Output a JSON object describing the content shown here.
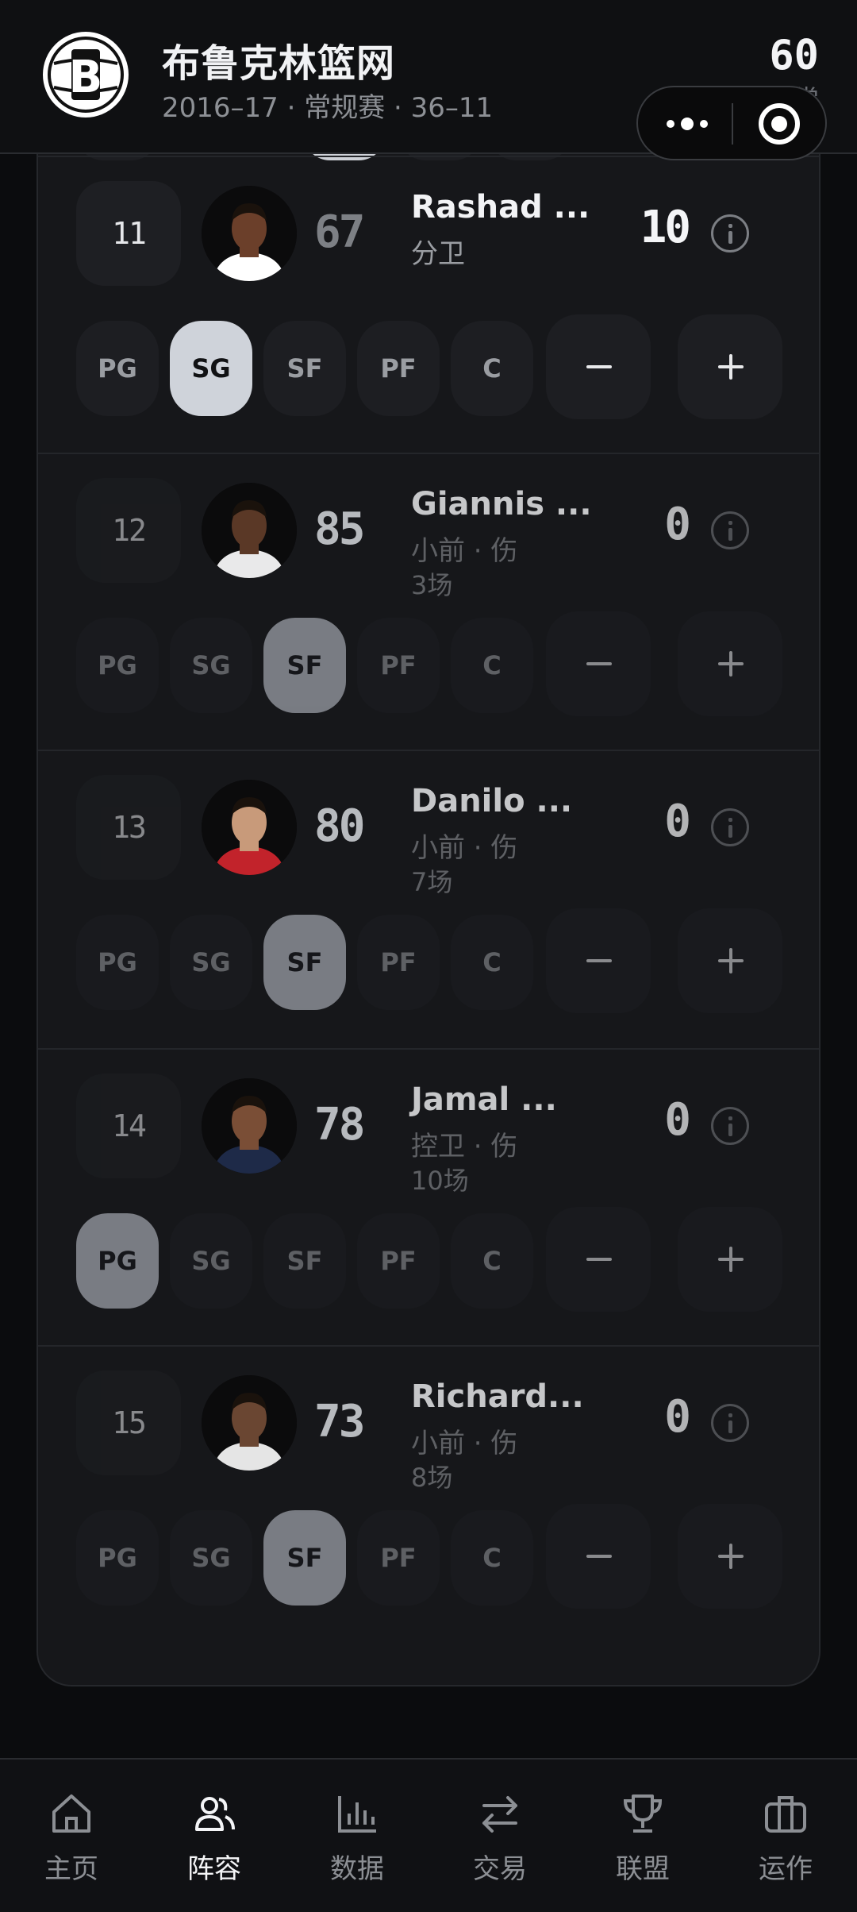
{
  "header": {
    "team_name": "布鲁克林篮网",
    "meta": "2016–17 · 常规赛 · 36–11",
    "score": "60",
    "score_label": "正常"
  },
  "players": [
    {
      "jersey": "11",
      "rating": "67",
      "name": "Rashad ...",
      "info": "分卫",
      "games": "",
      "minutes": "10",
      "active_position": "SG",
      "injured": false
    },
    {
      "jersey": "12",
      "rating": "85",
      "name": "Giannis ...",
      "info": "小前 · 伤",
      "games": "3场",
      "minutes": "0",
      "active_position": "SF",
      "injured": true
    },
    {
      "jersey": "13",
      "rating": "80",
      "name": "Danilo ...",
      "info": "小前 · 伤",
      "games": "7场",
      "minutes": "0",
      "active_position": "SF",
      "injured": true
    },
    {
      "jersey": "14",
      "rating": "78",
      "name": "Jamal ...",
      "info": "控卫 · 伤",
      "games": "10场",
      "minutes": "0",
      "active_position": "PG",
      "injured": true
    },
    {
      "jersey": "15",
      "rating": "73",
      "name": "Richard...",
      "info": "小前 · 伤",
      "games": "8场",
      "minutes": "0",
      "active_position": "SF",
      "injured": true
    }
  ],
  "positions": [
    "PG",
    "SG",
    "SF",
    "PF",
    "C"
  ],
  "tabs": [
    {
      "label": "主页",
      "icon": "home-icon"
    },
    {
      "label": "阵容",
      "icon": "roster-icon"
    },
    {
      "label": "数据",
      "icon": "stats-icon"
    },
    {
      "label": "交易",
      "icon": "trade-icon"
    },
    {
      "label": "联盟",
      "icon": "trophy-icon"
    },
    {
      "label": "运作",
      "icon": "briefcase-icon"
    }
  ],
  "active_tab": "阵容",
  "colors": {
    "background": "#0b0c0e",
    "card": "#16171a",
    "chip": "#1d1e22",
    "chip_active": "#cfd3da",
    "text_primary": "#f2f3f5",
    "text_muted": "#9a9da2"
  }
}
